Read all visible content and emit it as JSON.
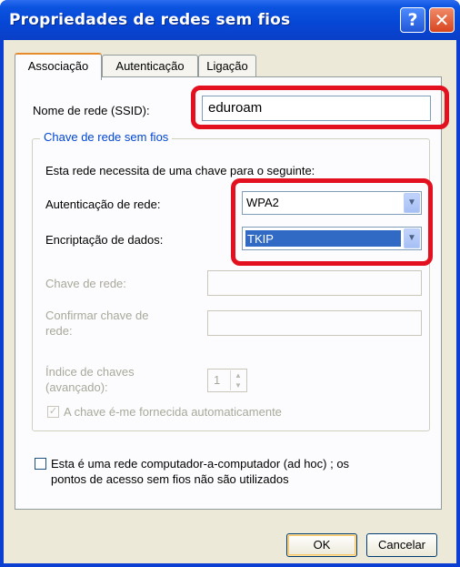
{
  "window": {
    "title": "Propriedades de redes sem fios",
    "help_glyph": "?",
    "close_glyph": "✕"
  },
  "tabs": [
    {
      "label": "Associação"
    },
    {
      "label": "Autenticação"
    },
    {
      "label": "Ligação"
    }
  ],
  "ssid": {
    "label": "Nome de rede (SSID):",
    "value": "eduroam"
  },
  "wireless_key_group": {
    "title": "Chave de rede sem fios",
    "description": "Esta rede necessita de uma chave para o seguinte:",
    "auth": {
      "label": "Autenticação de rede:",
      "value": "WPA2"
    },
    "encryption": {
      "label": "Encriptação de dados:",
      "value": "TKIP"
    },
    "network_key": {
      "label": "Chave de rede:",
      "value": ""
    },
    "confirm_key": {
      "label_line1": "Confirmar chave de",
      "label_line2": "rede:",
      "value": ""
    },
    "key_index": {
      "label_line1": "Índice de chaves",
      "label_line2": "(avançado):",
      "value": "1"
    },
    "auto_key": {
      "label": "A chave é-me fornecida automaticamente",
      "checked": true
    }
  },
  "adhoc": {
    "line1": "Esta é uma rede computador-a-computador (ad hoc) ; os",
    "line2": "pontos de acesso sem fios não são utilizados",
    "checked": false
  },
  "buttons": {
    "ok": "OK",
    "cancel": "Cancelar"
  },
  "colors": {
    "highlight": "#e3111f",
    "title_bar": "#0a3fd1",
    "selection": "#316ac5"
  }
}
